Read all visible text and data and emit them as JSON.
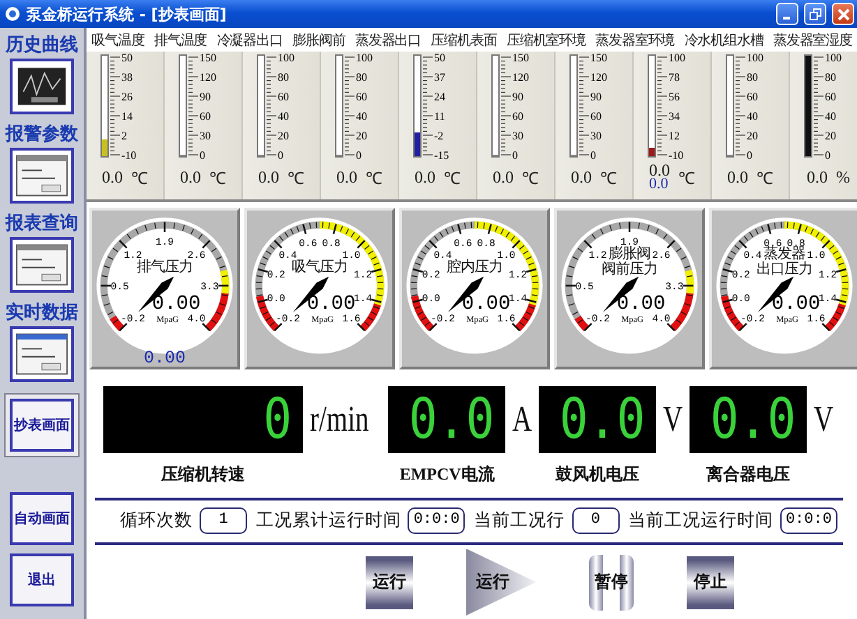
{
  "window": {
    "title": "泵金桥运行系统 - [抄表画面]"
  },
  "sidebar": {
    "items": [
      {
        "label": "历史曲线",
        "kind": "thumb",
        "selected": false
      },
      {
        "label": "报警参数",
        "kind": "thumb",
        "selected": false
      },
      {
        "label": "报表查询",
        "kind": "thumb",
        "selected": false
      },
      {
        "label": "实时数据",
        "kind": "thumb",
        "selected": false
      },
      {
        "label": "抄表画面",
        "kind": "button",
        "selected": true
      },
      {
        "label": "自动画面",
        "kind": "button",
        "selected": false
      },
      {
        "label": "退出",
        "kind": "button",
        "selected": false
      }
    ]
  },
  "thermometers": [
    {
      "label": "吸气温度",
      "ticks": [
        "50",
        "38",
        "26",
        "14",
        "2",
        "-10"
      ],
      "level": 0.17,
      "color": "#c8c020",
      "reading": "0.0",
      "unit": "℃"
    },
    {
      "label": "排气温度",
      "ticks": [
        "150",
        "120",
        "90",
        "60",
        "30",
        "0"
      ],
      "level": 0,
      "reading": "0.0",
      "unit": "℃"
    },
    {
      "label": "冷凝器出口",
      "ticks": [
        "100",
        "80",
        "60",
        "40",
        "20",
        "0"
      ],
      "level": 0,
      "reading": "0.0",
      "unit": "℃"
    },
    {
      "label": "膨胀阀前",
      "ticks": [
        "100",
        "80",
        "60",
        "40",
        "20",
        "0"
      ],
      "level": 0,
      "reading": "0.0",
      "unit": "℃"
    },
    {
      "label": "蒸发器出口",
      "ticks": [
        "50",
        "37",
        "24",
        "11",
        "-2",
        "-15"
      ],
      "level": 0.23,
      "color": "#2020a0",
      "reading": "0.0",
      "unit": "℃"
    },
    {
      "label": "压缩机表面",
      "ticks": [
        "150",
        "120",
        "90",
        "60",
        "30",
        "0"
      ],
      "level": 0,
      "reading": "0.0",
      "unit": "℃"
    },
    {
      "label": "压缩机室环境",
      "ticks": [
        "150",
        "120",
        "90",
        "60",
        "30",
        "0"
      ],
      "level": 0,
      "reading": "0.0",
      "unit": "℃"
    },
    {
      "label": "蒸发器室环境",
      "ticks": [
        "100",
        "78",
        "56",
        "34",
        "12",
        "-10"
      ],
      "level": 0.09,
      "color": "#a01818",
      "reading": "0.0",
      "reading_2": "0.0",
      "unit": "℃"
    },
    {
      "label": "冷水机组水槽",
      "ticks": [
        "100",
        "80",
        "60",
        "40",
        "20",
        "0"
      ],
      "level": 0,
      "reading": "0.0",
      "unit": "℃"
    },
    {
      "label": "蒸发器室湿度",
      "ticks": [
        "100",
        "80",
        "60",
        "40",
        "20",
        "0"
      ],
      "level": 1,
      "color": "#101010",
      "reading": "0.0",
      "unit": "%"
    }
  ],
  "gauges": [
    {
      "title_lines": [
        "排气压力"
      ],
      "kind": "wide",
      "scale": [
        "-0.2",
        "0.5",
        "1.2",
        "1.9",
        "2.6",
        "3.3",
        "4.0"
      ],
      "reading": "0.00",
      "unit": "MpaG",
      "reading_2": "0.00"
    },
    {
      "title_lines": [
        "吸气压力"
      ],
      "kind": "narrow",
      "scale": [
        "-0.2",
        "0.0",
        "0.2",
        "0.4",
        "0.6",
        "0.8",
        "1.0",
        "1.2",
        "1.4",
        "1.6"
      ],
      "reading": "0.00",
      "unit": "MpaG"
    },
    {
      "title_lines": [
        "腔内压力"
      ],
      "kind": "narrow",
      "scale": [
        "-0.2",
        "0.0",
        "0.2",
        "0.4",
        "0.6",
        "0.8",
        "1.0",
        "1.2",
        "1.4",
        "1.6"
      ],
      "reading": "0.00",
      "unit": "MpaG"
    },
    {
      "title_lines": [
        "膨胀阀",
        "阀前压力"
      ],
      "kind": "wide",
      "scale": [
        "-0.2",
        "0.5",
        "1.2",
        "1.9",
        "2.6",
        "3.3",
        "4.0"
      ],
      "reading": "0.00",
      "unit": "MpaG"
    },
    {
      "title_lines": [
        "蒸发器",
        "出口压力"
      ],
      "kind": "narrow",
      "scale": [
        "-0.2",
        "0.0",
        "0.2",
        "0.4",
        "0.6",
        "0.8",
        "1.0",
        "1.2",
        "1.4",
        "1.6"
      ],
      "reading": "0.00",
      "unit": "MpaG"
    }
  ],
  "displays": [
    {
      "value": "0",
      "unit": "r/min",
      "label": "压缩机转速",
      "wide": true
    },
    {
      "value": "0.0",
      "unit": "A",
      "label": "EMPCV电流",
      "wide": false
    },
    {
      "value": "0.0",
      "unit": "V",
      "label": "鼓风机电压",
      "wide": false
    },
    {
      "value": "0.0",
      "unit": "V",
      "label": "离合器电压",
      "wide": false
    }
  ],
  "counters": [
    {
      "label": "循环次数",
      "value": "1"
    },
    {
      "label": "工况累计运行时间",
      "value": "0:0:0"
    },
    {
      "label": "当前工况行",
      "value": "0"
    },
    {
      "label": "当前工况运行时间",
      "value": "0:0:0"
    }
  ],
  "buttons": [
    {
      "label": "运行",
      "kind": "square"
    },
    {
      "label": "运行",
      "kind": "arrow"
    },
    {
      "label": "暂停",
      "kind": "pause"
    },
    {
      "label": "停止",
      "kind": "square"
    }
  ]
}
